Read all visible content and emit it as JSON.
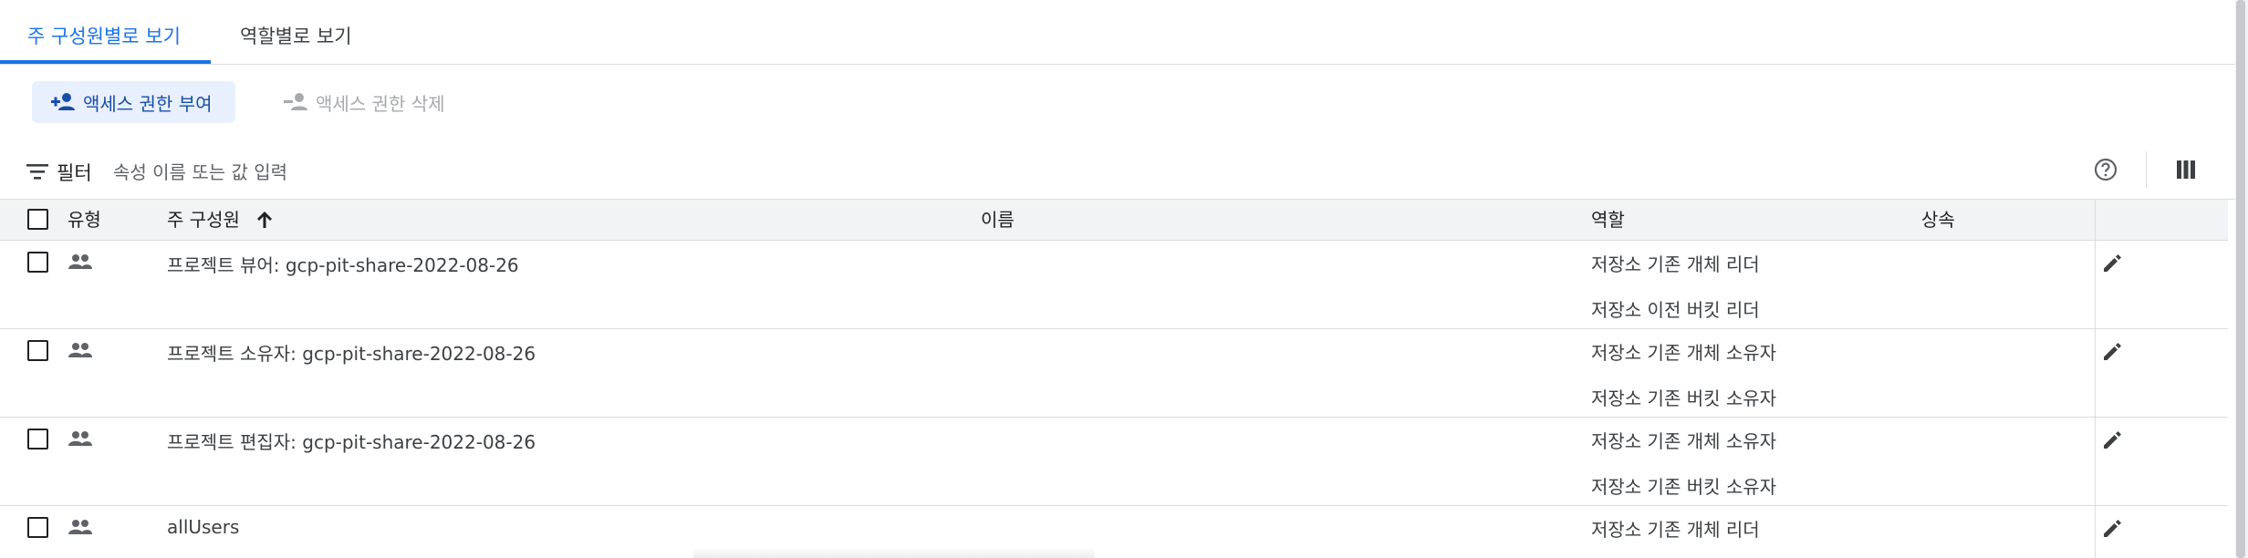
{
  "tabs": [
    {
      "label": "주 구성원별로 보기",
      "active": true
    },
    {
      "label": "역할별로 보기",
      "active": false
    }
  ],
  "actions": {
    "grant_label": "액세스 권한 부여",
    "remove_label": "액세스 권한 삭제"
  },
  "filter": {
    "label": "필터",
    "placeholder": "속성 이름 또는 값 입력"
  },
  "table": {
    "headers": {
      "type": "유형",
      "principal": "주 구성원",
      "name": "이름",
      "role": "역할",
      "inheritance": "상속"
    },
    "sort": {
      "column": "principal",
      "direction": "ascending"
    },
    "rows": [
      {
        "type_icon": "group-icon",
        "principal": "프로젝트 뷰어: gcp-pit-share-2022-08-26",
        "name": "",
        "roles": [
          "저장소 기존 개체 리더",
          "저장소 이전 버킷 리더"
        ],
        "inheritance": ""
      },
      {
        "type_icon": "group-icon",
        "principal": "프로젝트 소유자: gcp-pit-share-2022-08-26",
        "name": "",
        "roles": [
          "저장소 기존 개체 소유자",
          "저장소 기존 버킷 소유자"
        ],
        "inheritance": ""
      },
      {
        "type_icon": "group-icon",
        "principal": "프로젝트 편집자: gcp-pit-share-2022-08-26",
        "name": "",
        "roles": [
          "저장소 기존 개체 소유자",
          "저장소 기존 버킷 소유자"
        ],
        "inheritance": ""
      },
      {
        "type_icon": "group-icon",
        "principal": "allUsers",
        "name": "",
        "roles": [
          "저장소 기존 개체 리더"
        ],
        "inheritance": ""
      }
    ]
  },
  "colors": {
    "accent": "#1a73e8",
    "grant_bg": "#e8f0fe",
    "header_bg": "#f1f3f4",
    "disabled": "#a7a9ac"
  }
}
